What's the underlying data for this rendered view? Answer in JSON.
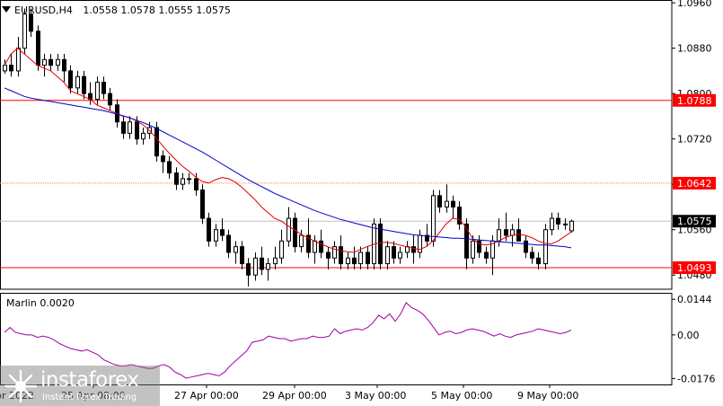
{
  "header": {
    "symbol": "EURUSD,H4",
    "ohlc": "1.0558 1.0578 1.0555 1.0575"
  },
  "indicator": {
    "label": "Marlin 0.0020"
  },
  "logo": {
    "brand": "instaforex",
    "tagline": "Instant Forex Trading"
  },
  "colors": {
    "background": "#ffffff",
    "candle": "#000000",
    "ma_fast": "#e00000",
    "ma_slow": "#0000cc",
    "marlin": "#a000a0",
    "level_line": "#ff0000",
    "level_dotted": "#ff8040",
    "label_red": "#ff0000",
    "label_black": "#000000"
  },
  "chart_data": [
    {
      "type": "candlestick",
      "timeframe": "H4",
      "price_axis": {
        "ylim": [
          1.0455,
          1.0965
        ],
        "ticks": [
          "1.0960",
          "1.0880",
          "1.0800",
          "1.0720",
          "1.0640",
          "1.0560",
          "1.0480"
        ]
      },
      "time_axis": {
        "ticks": [
          "21 Apr 2022",
          "25 Apr 08:00",
          "27 Apr 00:00",
          "29 Apr 00:00",
          "3 May 00:00",
          "5 May 00:00",
          "9 May 00:00"
        ]
      },
      "levels": [
        {
          "price": 1.0788,
          "label": "1.0788",
          "style": "solid"
        },
        {
          "price": 1.0642,
          "label": "1.0642",
          "style": "dotted"
        },
        {
          "price": 1.0493,
          "label": "1.0493",
          "style": "solid"
        }
      ],
      "current_price": {
        "price": 1.0575,
        "label": "1.0575"
      },
      "candles": [
        [
          1.084,
          1.086,
          1.0835,
          1.085
        ],
        [
          1.085,
          1.087,
          1.083,
          1.084
        ],
        [
          1.084,
          1.09,
          1.083,
          1.088
        ],
        [
          1.088,
          1.095,
          1.087,
          1.094
        ],
        [
          1.094,
          1.095,
          1.09,
          1.091
        ],
        [
          1.091,
          1.092,
          1.084,
          1.085
        ],
        [
          1.085,
          1.087,
          1.083,
          1.086
        ],
        [
          1.086,
          1.087,
          1.084,
          1.085
        ],
        [
          1.085,
          1.087,
          1.084,
          1.086
        ],
        [
          1.086,
          1.087,
          1.082,
          1.084
        ],
        [
          1.084,
          1.085,
          1.08,
          1.081
        ],
        [
          1.081,
          1.084,
          1.08,
          1.083
        ],
        [
          1.083,
          1.084,
          1.079,
          1.08
        ],
        [
          1.08,
          1.082,
          1.078,
          1.079
        ],
        [
          1.079,
          1.083,
          1.078,
          1.082
        ],
        [
          1.082,
          1.083,
          1.079,
          1.08
        ],
        [
          1.08,
          1.081,
          1.077,
          1.078
        ],
        [
          1.078,
          1.079,
          1.074,
          1.075
        ],
        [
          1.075,
          1.076,
          1.072,
          1.073
        ],
        [
          1.073,
          1.076,
          1.072,
          1.075
        ],
        [
          1.075,
          1.076,
          1.071,
          1.072
        ],
        [
          1.072,
          1.074,
          1.071,
          1.073
        ],
        [
          1.073,
          1.075,
          1.072,
          1.074
        ],
        [
          1.074,
          1.075,
          1.068,
          1.069
        ],
        [
          1.069,
          1.07,
          1.066,
          1.068
        ],
        [
          1.068,
          1.069,
          1.065,
          1.066
        ],
        [
          1.066,
          1.067,
          1.063,
          1.064
        ],
        [
          1.064,
          1.066,
          1.063,
          1.065
        ],
        [
          1.065,
          1.066,
          1.064,
          1.065
        ],
        [
          1.065,
          1.066,
          1.062,
          1.063
        ],
        [
          1.063,
          1.064,
          1.057,
          1.058
        ],
        [
          1.058,
          1.059,
          1.053,
          1.054
        ],
        [
          1.054,
          1.057,
          1.053,
          1.056
        ],
        [
          1.056,
          1.058,
          1.054,
          1.055
        ],
        [
          1.055,
          1.056,
          1.051,
          1.052
        ],
        [
          1.052,
          1.054,
          1.05,
          1.053
        ],
        [
          1.053,
          1.054,
          1.049,
          1.05
        ],
        [
          1.05,
          1.051,
          1.046,
          1.048
        ],
        [
          1.048,
          1.052,
          1.047,
          1.051
        ],
        [
          1.051,
          1.053,
          1.048,
          1.049
        ],
        [
          1.049,
          1.051,
          1.047,
          1.05
        ],
        [
          1.05,
          1.053,
          1.049,
          1.051
        ],
        [
          1.051,
          1.056,
          1.05,
          1.054
        ],
        [
          1.054,
          1.06,
          1.053,
          1.058
        ],
        [
          1.058,
          1.059,
          1.052,
          1.053
        ],
        [
          1.053,
          1.056,
          1.052,
          1.055
        ],
        [
          1.055,
          1.058,
          1.051,
          1.052
        ],
        [
          1.052,
          1.055,
          1.05,
          1.054
        ],
        [
          1.054,
          1.056,
          1.051,
          1.052
        ],
        [
          1.052,
          1.053,
          1.049,
          1.051
        ],
        [
          1.051,
          1.054,
          1.05,
          1.053
        ],
        [
          1.053,
          1.055,
          1.049,
          1.05
        ],
        [
          1.05,
          1.052,
          1.049,
          1.051
        ],
        [
          1.051,
          1.053,
          1.049,
          1.05
        ],
        [
          1.05,
          1.053,
          1.049,
          1.052
        ],
        [
          1.052,
          1.053,
          1.049,
          1.05
        ],
        [
          1.05,
          1.058,
          1.049,
          1.057
        ],
        [
          1.057,
          1.058,
          1.049,
          1.05
        ],
        [
          1.05,
          1.054,
          1.049,
          1.053
        ],
        [
          1.053,
          1.054,
          1.05,
          1.051
        ],
        [
          1.051,
          1.053,
          1.05,
          1.052
        ],
        [
          1.052,
          1.054,
          1.051,
          1.053
        ],
        [
          1.053,
          1.055,
          1.05,
          1.052
        ],
        [
          1.052,
          1.056,
          1.051,
          1.055
        ],
        [
          1.055,
          1.057,
          1.053,
          1.054
        ],
        [
          1.054,
          1.063,
          1.053,
          1.062
        ],
        [
          1.062,
          1.063,
          1.059,
          1.06
        ],
        [
          1.06,
          1.064,
          1.059,
          1.061
        ],
        [
          1.061,
          1.062,
          1.058,
          1.06
        ],
        [
          1.06,
          1.061,
          1.056,
          1.057
        ],
        [
          1.057,
          1.058,
          1.049,
          1.051
        ],
        [
          1.051,
          1.055,
          1.05,
          1.054
        ],
        [
          1.054,
          1.055,
          1.051,
          1.052
        ],
        [
          1.052,
          1.053,
          1.05,
          1.051
        ],
        [
          1.051,
          1.055,
          1.048,
          1.054
        ],
        [
          1.054,
          1.058,
          1.053,
          1.056
        ],
        [
          1.056,
          1.059,
          1.054,
          1.055
        ],
        [
          1.055,
          1.057,
          1.053,
          1.056
        ],
        [
          1.056,
          1.058,
          1.054,
          1.054
        ],
        [
          1.054,
          1.055,
          1.051,
          1.052
        ],
        [
          1.052,
          1.053,
          1.05,
          1.051
        ],
        [
          1.051,
          1.052,
          1.049,
          1.05
        ],
        [
          1.05,
          1.057,
          1.049,
          1.056
        ],
        [
          1.056,
          1.059,
          1.055,
          1.058
        ],
        [
          1.058,
          1.059,
          1.056,
          1.057
        ],
        [
          1.057,
          1.058,
          1.056,
          1.057
        ],
        [
          1.0558,
          1.0578,
          1.0555,
          1.0575
        ]
      ],
      "ma_fast": [
        1.085,
        1.087,
        1.088,
        1.087,
        1.086,
        1.085,
        1.0845,
        1.084,
        1.083,
        1.082,
        1.0805,
        1.08,
        1.0795,
        1.079,
        1.078,
        1.0775,
        1.077,
        1.0765,
        1.076,
        1.0758,
        1.0752,
        1.0745,
        1.0735,
        1.0722,
        1.0708,
        1.0695,
        1.0683,
        1.0672,
        1.0663,
        1.0653,
        1.0645,
        1.0642,
        1.0648,
        1.0652,
        1.065,
        1.0644,
        1.0635,
        1.0624,
        1.0613,
        1.06,
        1.059,
        1.058,
        1.0575,
        1.0567,
        1.056,
        1.0552,
        1.0546,
        1.054,
        1.0535,
        1.053,
        1.0526,
        1.0523,
        1.0521,
        1.052,
        1.0525,
        1.053,
        1.0534,
        1.0537,
        1.0538,
        1.0536,
        1.0533,
        1.053,
        1.0527,
        1.0525,
        1.053,
        1.054,
        1.0555,
        1.057,
        1.058,
        1.0578,
        1.0565,
        1.0545,
        1.0535,
        1.0533,
        1.0535,
        1.054,
        1.0546,
        1.055,
        1.0552,
        1.055,
        1.0546,
        1.054,
        1.0536,
        1.0535,
        1.054,
        1.0548,
        1.0556
      ],
      "ma_slow": [
        1.081,
        1.0805,
        1.08,
        1.0795,
        1.0792,
        1.079,
        1.0788,
        1.0786,
        1.0784,
        1.0782,
        1.078,
        1.0778,
        1.0776,
        1.0774,
        1.0772,
        1.077,
        1.0767,
        1.0764,
        1.0761,
        1.0757,
        1.0753,
        1.0749,
        1.0744,
        1.0739,
        1.0733,
        1.0727,
        1.0721,
        1.0715,
        1.0709,
        1.0703,
        1.0697,
        1.069,
        1.0683,
        1.0676,
        1.0669,
        1.0662,
        1.0655,
        1.0648,
        1.0642,
        1.0636,
        1.063,
        1.0624,
        1.0619,
        1.0614,
        1.0609,
        1.0604,
        1.0599,
        1.0594,
        1.059,
        1.0586,
        1.0582,
        1.0578,
        1.0575,
        1.0572,
        1.0569,
        1.0566,
        1.0563,
        1.0561,
        1.0559,
        1.0557,
        1.0555,
        1.0553,
        1.0551,
        1.055,
        1.0549,
        1.0548,
        1.0547,
        1.0546,
        1.0545,
        1.0545,
        1.0544,
        1.0543,
        1.0542,
        1.0541,
        1.054,
        1.0539,
        1.0538,
        1.0537,
        1.0536,
        1.0535,
        1.0534,
        1.0533,
        1.0533,
        1.0532,
        1.0531,
        1.053,
        1.0528
      ]
    },
    {
      "type": "line",
      "name": "Marlin 0.0020",
      "y_axis": {
        "ylim": [
          -0.02,
          0.017
        ],
        "ticks": [
          "0.0144",
          "0.00",
          "-0.0176"
        ]
      },
      "values": [
        0.001,
        0.003,
        0.001,
        0.0005,
        0.0,
        0.0,
        -0.001,
        -0.0005,
        -0.001,
        -0.002,
        -0.0035,
        -0.0045,
        -0.0055,
        -0.006,
        -0.0065,
        -0.006,
        -0.007,
        -0.008,
        -0.01,
        -0.011,
        -0.012,
        -0.0125,
        -0.0125,
        -0.012,
        -0.0125,
        -0.013,
        -0.0135,
        -0.0135,
        -0.0125,
        -0.012,
        -0.013,
        -0.015,
        -0.016,
        -0.0175,
        -0.017,
        -0.0165,
        -0.016,
        -0.0155,
        -0.016,
        -0.0165,
        -0.015,
        -0.0125,
        -0.0105,
        -0.0085,
        -0.0065,
        -0.003,
        -0.0025,
        -0.002,
        -0.0005,
        -0.001,
        -0.0015,
        -0.0015,
        -0.0025,
        -0.002,
        -0.0015,
        -0.0015,
        -0.0005,
        -0.001,
        -0.001,
        -0.0005,
        0.0025,
        0.0005,
        0.0015,
        0.002,
        0.0025,
        0.002,
        0.003,
        0.005,
        0.008,
        0.0065,
        0.0085,
        0.0055,
        0.0085,
        0.013,
        0.011,
        0.01,
        0.0085,
        0.006,
        0.003,
        0.0,
        0.001,
        0.0015,
        0.0005,
        0.001,
        0.002,
        0.0025,
        0.002,
        0.0015,
        0.0005,
        -0.0005,
        0.0005,
        -0.0005,
        -0.001,
        0.0,
        0.0005,
        0.001,
        0.0015,
        0.0025,
        0.002,
        0.0015,
        0.001,
        0.0005,
        0.001,
        0.002
      ]
    }
  ]
}
